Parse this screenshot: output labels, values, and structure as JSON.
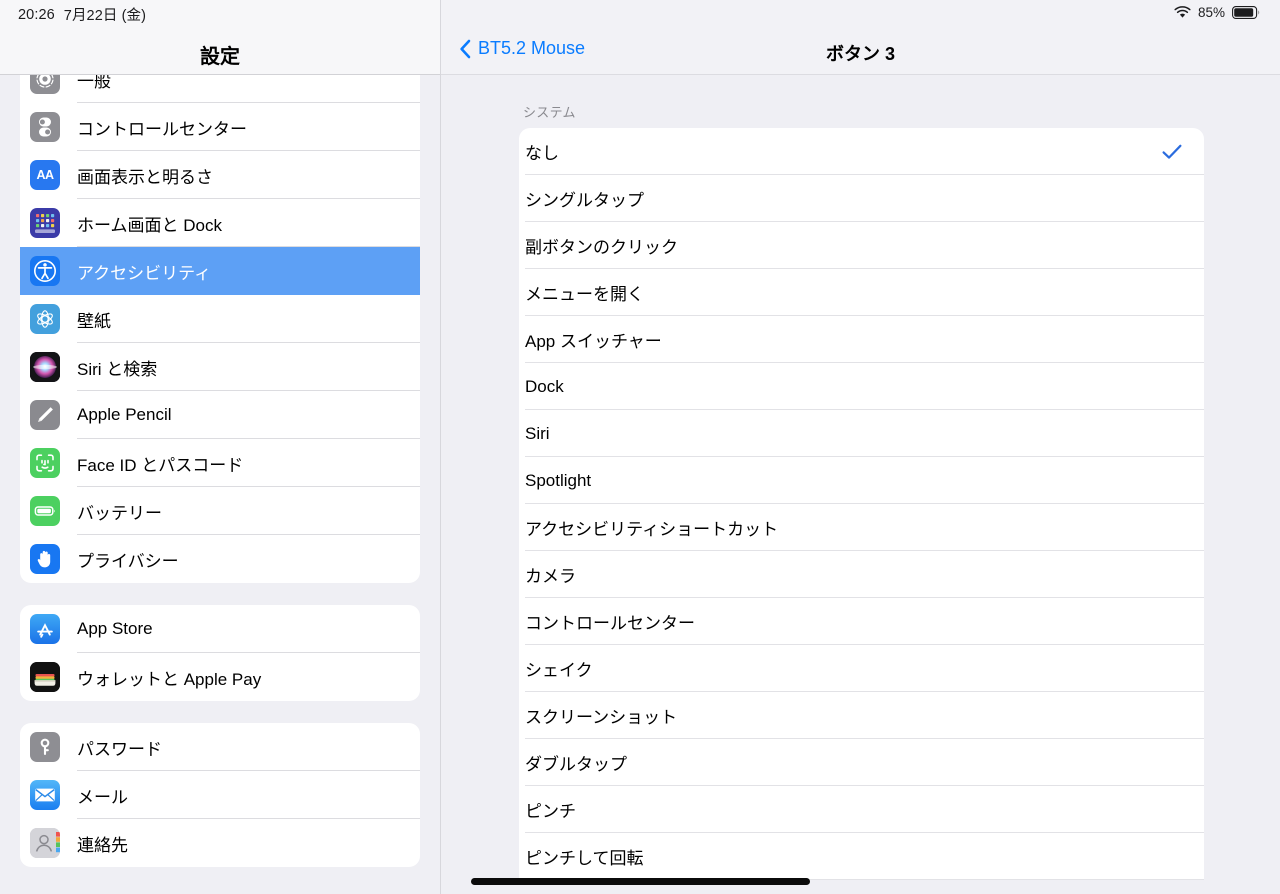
{
  "status_bar": {
    "time": "20:26",
    "date": "7月22日 (金)",
    "wifi_icon": "wifi-icon",
    "battery_percent": "85%",
    "battery_icon": "battery-icon"
  },
  "sidebar": {
    "title": "設定",
    "groups": [
      {
        "clipped_top": true,
        "items": [
          {
            "label": "一般",
            "icon": "gear-icon",
            "icon_class": "ic-general",
            "name": "sidebar-item-general",
            "selected": false
          },
          {
            "label": "コントロールセンター",
            "icon": "control-center-icon",
            "icon_class": "ic-control",
            "name": "sidebar-item-control-center",
            "selected": false
          },
          {
            "label": "画面表示と明るさ",
            "icon": "display-brightness-icon",
            "icon_class": "ic-display",
            "name": "sidebar-item-display-brightness",
            "selected": false
          },
          {
            "label": "ホーム画面と Dock",
            "icon": "home-screen-dock-icon",
            "icon_class": "ic-home",
            "name": "sidebar-item-home-screen-dock",
            "selected": false
          },
          {
            "label": "アクセシビリティ",
            "icon": "accessibility-icon",
            "icon_class": "ic-access",
            "name": "sidebar-item-accessibility",
            "selected": true
          },
          {
            "label": "壁紙",
            "icon": "wallpaper-icon",
            "icon_class": "ic-wallpaper",
            "name": "sidebar-item-wallpaper",
            "selected": false
          },
          {
            "label": "Siri と検索",
            "icon": "siri-icon",
            "icon_class": "ic-siri",
            "name": "sidebar-item-siri-search",
            "selected": false
          },
          {
            "label": "Apple Pencil",
            "icon": "pencil-icon",
            "icon_class": "ic-pencil",
            "name": "sidebar-item-apple-pencil",
            "selected": false
          },
          {
            "label": "Face ID とパスコード",
            "icon": "face-id-icon",
            "icon_class": "ic-faceid",
            "name": "sidebar-item-face-id-passcode",
            "selected": false
          },
          {
            "label": "バッテリー",
            "icon": "battery-icon",
            "icon_class": "ic-battery",
            "name": "sidebar-item-battery",
            "selected": false
          },
          {
            "label": "プライバシー",
            "icon": "privacy-hand-icon",
            "icon_class": "ic-privacy",
            "name": "sidebar-item-privacy",
            "selected": false
          }
        ]
      },
      {
        "clipped_top": false,
        "items": [
          {
            "label": "App Store",
            "icon": "app-store-icon",
            "icon_class": "ic-appstore",
            "name": "sidebar-item-app-store",
            "selected": false
          },
          {
            "label": "ウォレットと Apple Pay",
            "icon": "wallet-icon",
            "icon_class": "ic-wallet",
            "name": "sidebar-item-wallet-apple-pay",
            "selected": false
          }
        ]
      },
      {
        "clipped_top": false,
        "items": [
          {
            "label": "パスワード",
            "icon": "key-icon",
            "icon_class": "ic-password",
            "name": "sidebar-item-passwords",
            "selected": false
          },
          {
            "label": "メール",
            "icon": "mail-icon",
            "icon_class": "ic-mail",
            "name": "sidebar-item-mail",
            "selected": false
          },
          {
            "label": "連絡先",
            "icon": "contacts-icon",
            "icon_class": "ic-contacts",
            "name": "sidebar-item-contacts",
            "selected": false
          }
        ]
      }
    ]
  },
  "detail": {
    "back_label": "BT5.2 Mouse",
    "back_icon": "chevron-left-icon",
    "title": "ボタン 3",
    "section_header": "システム",
    "selected_option": "なし",
    "check_icon": "checkmark-icon",
    "options": [
      {
        "label": "なし",
        "checked": true,
        "name": "option-none"
      },
      {
        "label": "シングルタップ",
        "checked": false,
        "name": "option-single-tap"
      },
      {
        "label": "副ボタンのクリック",
        "checked": false,
        "name": "option-secondary-click"
      },
      {
        "label": "メニューを開く",
        "checked": false,
        "name": "option-open-menu"
      },
      {
        "label": "App スイッチャー",
        "checked": false,
        "name": "option-app-switcher"
      },
      {
        "label": "Dock",
        "checked": false,
        "name": "option-dock"
      },
      {
        "label": "Siri",
        "checked": false,
        "name": "option-siri"
      },
      {
        "label": "Spotlight",
        "checked": false,
        "name": "option-spotlight"
      },
      {
        "label": "アクセシビリティショートカット",
        "checked": false,
        "name": "option-accessibility-shortcut"
      },
      {
        "label": "カメラ",
        "checked": false,
        "name": "option-camera"
      },
      {
        "label": "コントロールセンター",
        "checked": false,
        "name": "option-control-center"
      },
      {
        "label": "シェイク",
        "checked": false,
        "name": "option-shake"
      },
      {
        "label": "スクリーンショット",
        "checked": false,
        "name": "option-screenshot"
      },
      {
        "label": "ダブルタップ",
        "checked": false,
        "name": "option-double-tap"
      },
      {
        "label": "ピンチ",
        "checked": false,
        "name": "option-pinch"
      },
      {
        "label": "ピンチして回転",
        "checked": false,
        "name": "option-pinch-rotate"
      }
    ]
  },
  "colors": {
    "accent_blue": "#0a7cff",
    "selected_row_blue": "#5da0f5",
    "checkmark_blue": "#2b6cde",
    "panel_background": "#efeff4",
    "card_white": "#ffffff"
  },
  "home_indicator": "home-indicator"
}
